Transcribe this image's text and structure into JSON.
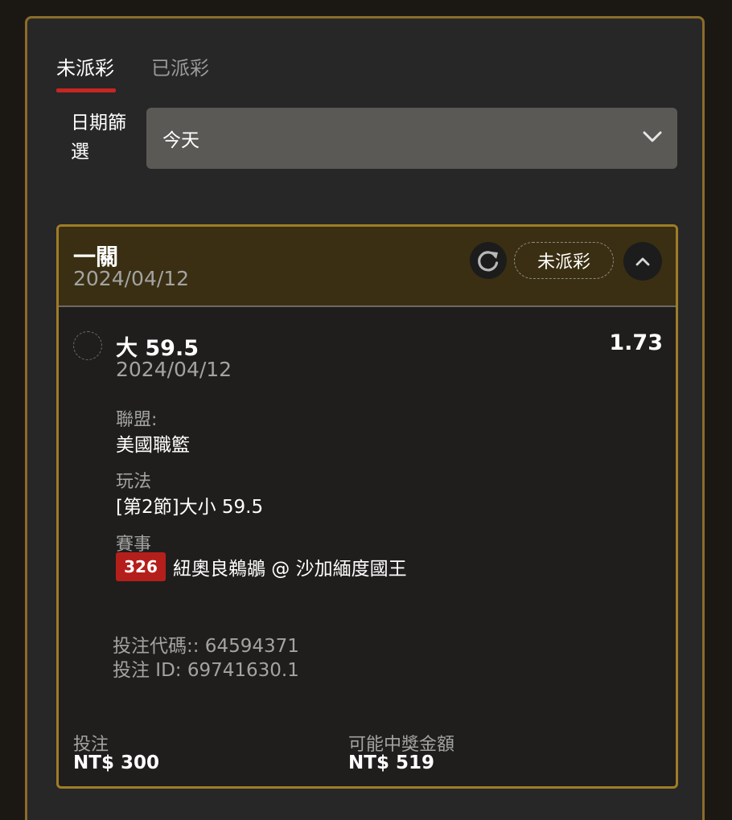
{
  "tabs": [
    {
      "label": "未派彩",
      "active": true
    },
    {
      "label": "已派彩",
      "active": false
    }
  ],
  "filter": {
    "label": "日期篩選",
    "selected": "今天",
    "icon": "chevron-down-icon"
  },
  "colors": {
    "accent_red": "#c72520",
    "border_gold": "#9f7c28",
    "header_bg": "#3a2f12",
    "badge_red": "#b51f1b"
  },
  "card": {
    "title": "一關",
    "date": "2024/04/12",
    "status": "未派彩",
    "refresh_icon": "refresh-icon",
    "collapse_icon": "chevron-up-icon",
    "bet": {
      "selection": "大 59.5",
      "odds": "1.73",
      "date": "2024/04/12",
      "league_label": "聯盟:",
      "league": "美國職籃",
      "market_label": "玩法",
      "market": "[第2節]大小 59.5",
      "event_label": "賽事",
      "event_id": "326",
      "event_name": "紐奧良鵜鶘 @ 沙加緬度國王"
    },
    "bet_code": "投注代碼:: 64594371",
    "bet_id": "投注 ID: 69741630.1",
    "stake_label": "投注",
    "stake": "NT$ 300",
    "payout_label": "可能中獎金額",
    "payout": "NT$ 519"
  }
}
